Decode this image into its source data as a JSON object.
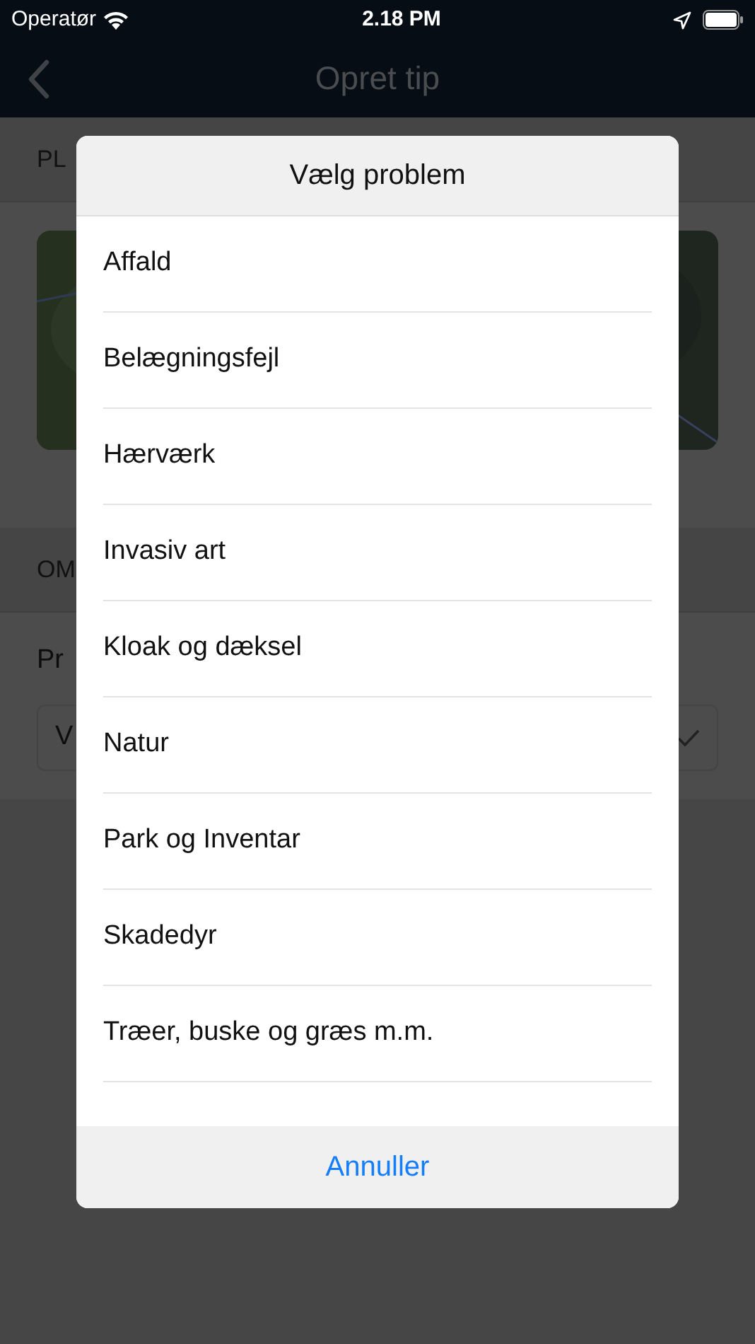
{
  "status_bar": {
    "carrier": "Operatør",
    "time": "2.18 PM"
  },
  "nav_bar": {
    "title": "Opret tip"
  },
  "sections": [
    {
      "header": "PL",
      "kind": "map"
    },
    {
      "header": "OM",
      "kind": "form",
      "label": "Pr",
      "field_value": "V"
    }
  ],
  "dialog": {
    "title": "Vælg problem",
    "items": [
      {
        "label": "Affald"
      },
      {
        "label": "Belægningsfejl"
      },
      {
        "label": "Hærværk"
      },
      {
        "label": "Invasiv art"
      },
      {
        "label": "Kloak og dæksel"
      },
      {
        "label": "Natur"
      },
      {
        "label": "Park og Inventar"
      },
      {
        "label": "Skadedyr"
      },
      {
        "label": "Træer, buske og græs m.m."
      }
    ],
    "cancel": "Annuller"
  }
}
